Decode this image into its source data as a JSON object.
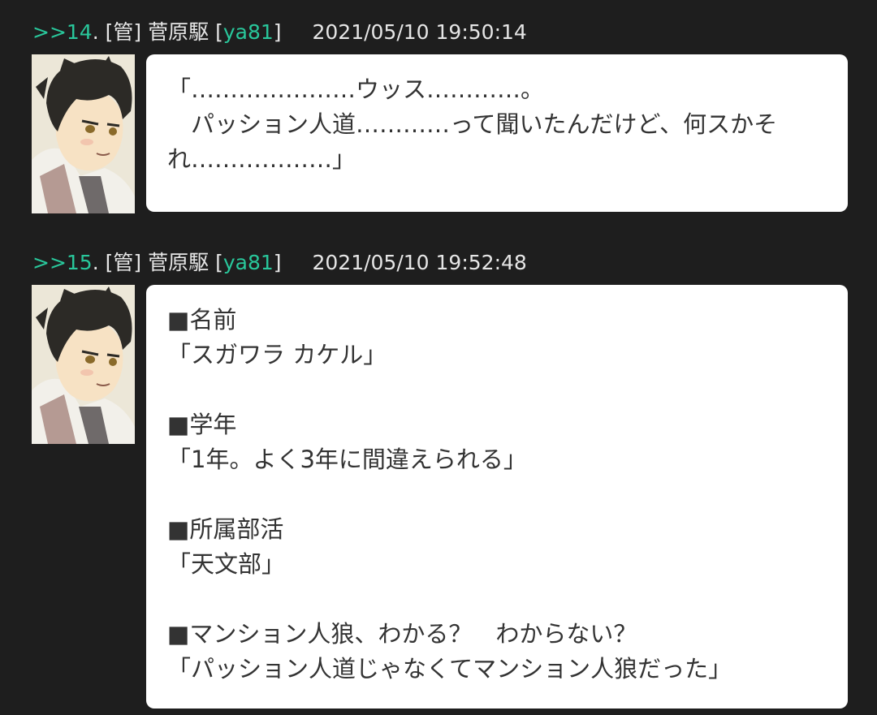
{
  "posts": [
    {
      "anchor": ">>14",
      "sep": ".",
      "tag": "[管]",
      "name": "菅原駆",
      "id_open": "[",
      "id": "ya81",
      "id_close": "]",
      "date": "2021/05/10 19:50:14",
      "lines": [
        "「…………………ウッス…………。",
        "　パッション人道…………って聞いたんだけど、何スかそ",
        "れ………………」"
      ]
    },
    {
      "anchor": ">>15",
      "sep": ".",
      "tag": "[管]",
      "name": "菅原駆",
      "id_open": "[",
      "id": "ya81",
      "id_close": "]",
      "date": "2021/05/10 19:52:48",
      "lines": [
        "■名前",
        "「スガワラ カケル」",
        "",
        "■学年",
        "「1年。よく3年に間違えられる」",
        "",
        "■所属部活",
        "「天文部」",
        "",
        "■マンション人狼、わかる？　わからない？",
        "「パッション人道じゃなくてマンション人狼だった」"
      ]
    }
  ],
  "colors": {
    "background": "#1e1e1e",
    "anchor": "#29c79b",
    "bubble": "#ffffff",
    "text": "#333333"
  }
}
